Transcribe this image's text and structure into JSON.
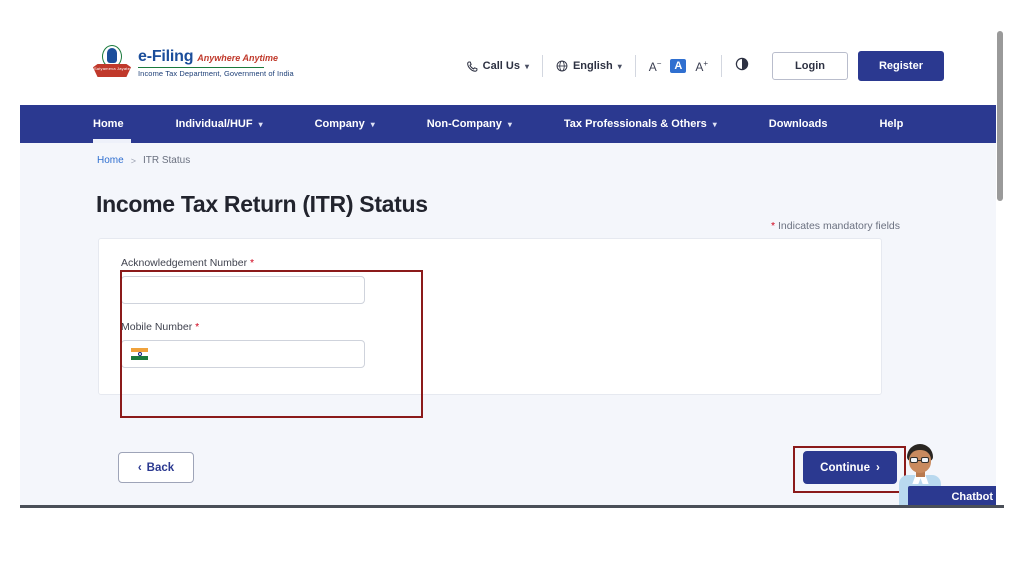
{
  "header": {
    "logo": {
      "brand": "e-Filing",
      "tagline": "Anywhere Anytime",
      "department": "Income Tax Department, Government of India",
      "emblem_motto": "Satyameva Jayate"
    },
    "call_us": "Call Us",
    "language": "English",
    "font_decrease": "A",
    "font_default": "A",
    "font_increase": "A",
    "contrast_icon": "contrast-icon",
    "login_label": "Login",
    "register_label": "Register"
  },
  "nav": {
    "items": [
      {
        "label": "Home",
        "has_dropdown": false,
        "active": true
      },
      {
        "label": "Individual/HUF",
        "has_dropdown": true,
        "active": false
      },
      {
        "label": "Company",
        "has_dropdown": true,
        "active": false
      },
      {
        "label": "Non-Company",
        "has_dropdown": true,
        "active": false
      },
      {
        "label": "Tax Professionals & Others",
        "has_dropdown": true,
        "active": false
      },
      {
        "label": "Downloads",
        "has_dropdown": false,
        "active": false
      },
      {
        "label": "Help",
        "has_dropdown": false,
        "active": false
      }
    ]
  },
  "breadcrumb": {
    "home": "Home",
    "separator": ">",
    "current": "ITR Status"
  },
  "main": {
    "title": "Income Tax Return (ITR) Status",
    "mandatory_note": "Indicates mandatory fields",
    "mandatory_star": "*",
    "fields": [
      {
        "label": "Acknowledgement Number",
        "required_star": "*",
        "value": "",
        "placeholder": ""
      },
      {
        "label": "Mobile Number",
        "required_star": "*",
        "value": "",
        "placeholder": "",
        "prefix_icon": "india-flag-icon"
      }
    ],
    "back_label": "Back",
    "back_chevron": "‹",
    "continue_label": "Continue",
    "continue_chevron": "›"
  },
  "chatbot": {
    "label": "Chatbot"
  },
  "colors": {
    "navy": "#2b3990",
    "page_bg": "#f4f6fb",
    "link_blue": "#2f6fd0",
    "required_red": "#d0021b",
    "highlight_red": "#8b1a1a",
    "flag_saffron": "#f0a23c",
    "flag_green": "#1a7a3c"
  }
}
